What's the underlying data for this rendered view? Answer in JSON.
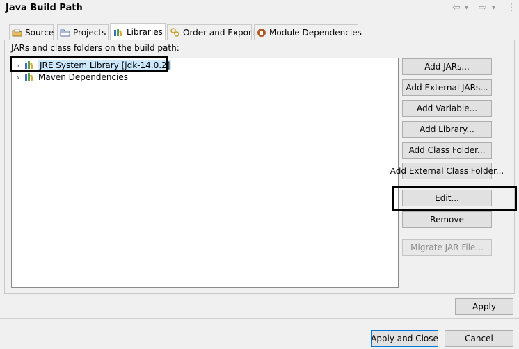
{
  "header": {
    "title": "Java Build Path",
    "nav_back_icon": "back-arrow-icon",
    "nav_forward_icon": "forward-arrow-icon",
    "menu_icon": "view-menu-icon",
    "back_glyph": "⇦",
    "forward_glyph": "⇨",
    "dropdown_glyph": "▾",
    "kebab_glyph": "⋮"
  },
  "tabs": [
    {
      "label": "Source",
      "icon": "source-folder-icon",
      "active": false
    },
    {
      "label": "Projects",
      "icon": "projects-icon",
      "active": false
    },
    {
      "label": "Libraries",
      "icon": "libraries-icon",
      "active": true
    },
    {
      "label": "Order and Export",
      "icon": "order-export-icon",
      "active": false
    },
    {
      "label": "Module Dependencies",
      "icon": "module-icon",
      "active": false
    }
  ],
  "libraries": {
    "caption": "JARs and class folders on the build path:",
    "tree": [
      {
        "label": "JRE System Library [jdk-14.0.2]",
        "selected": true,
        "highlighted": true
      },
      {
        "label": "Maven Dependencies",
        "selected": false,
        "highlighted": false
      }
    ],
    "buttons": [
      {
        "label": "Add JARs...",
        "enabled": true
      },
      {
        "label": "Add External JARs...",
        "enabled": true
      },
      {
        "label": "Add Variable...",
        "enabled": true
      },
      {
        "label": "Add Library...",
        "enabled": true
      },
      {
        "label": "Add Class Folder...",
        "enabled": true
      },
      {
        "label": "Add External Class Folder...",
        "enabled": true
      },
      {
        "label": "Edit...",
        "enabled": true,
        "highlighted": true
      },
      {
        "label": "Remove",
        "enabled": true
      },
      {
        "label": "Migrate JAR File...",
        "enabled": false
      }
    ]
  },
  "footer": {
    "apply_label": "Apply",
    "apply_close_label": "Apply and Close",
    "cancel_label": "Cancel"
  },
  "colors": {
    "selection": "#cce8ff",
    "highlight_border": "#000000",
    "primary_button_border": "#0078d7"
  }
}
